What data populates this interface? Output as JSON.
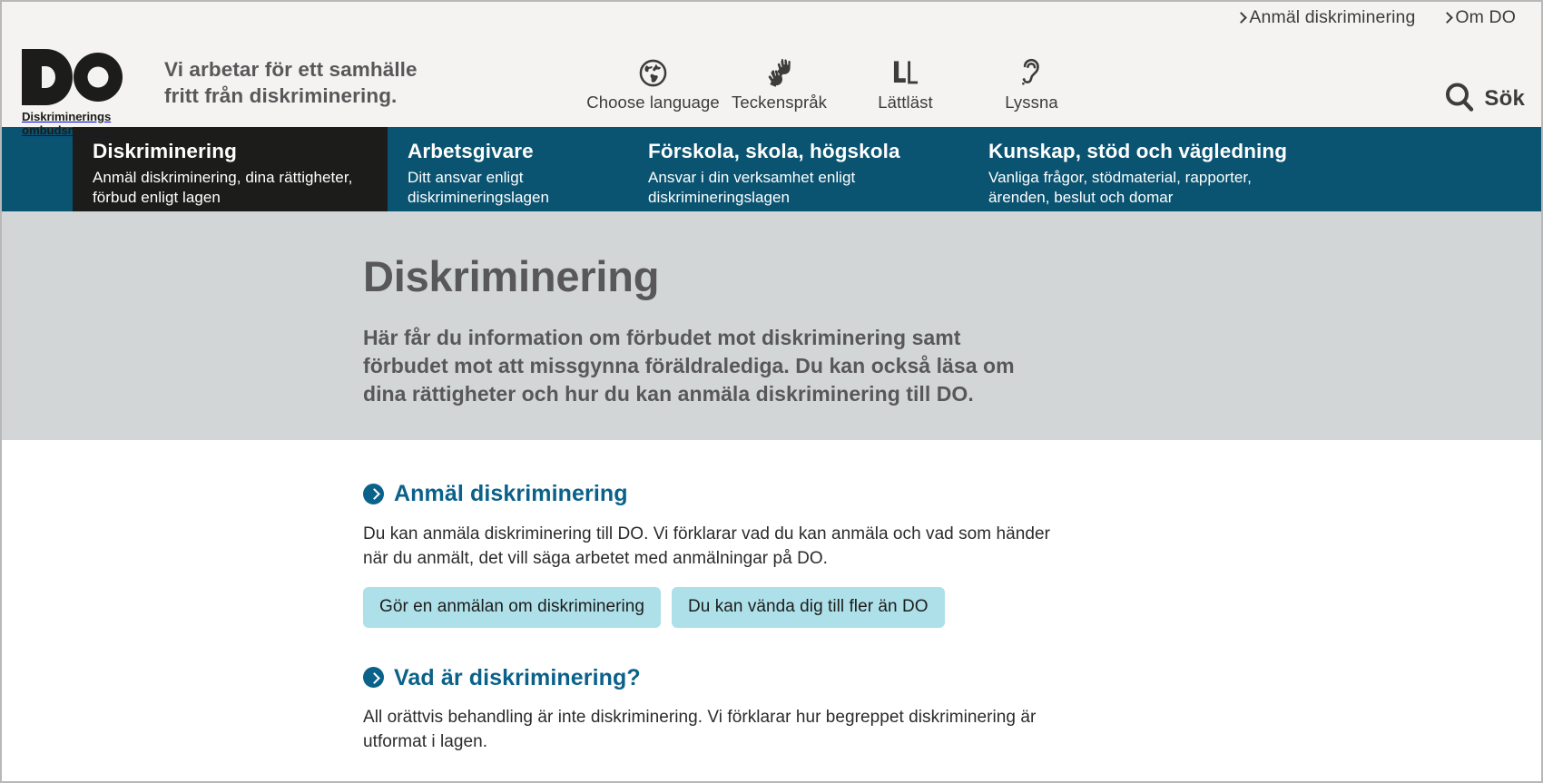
{
  "brand": {
    "logo_alt": "DO",
    "logo_words_line1": "Diskriminerings",
    "logo_words_line2": "ombudsmannen",
    "tagline_line1": "Vi arbetar för ett samhälle",
    "tagline_line2": "fritt från diskriminering."
  },
  "top_links": [
    {
      "label": "Anmäl diskriminering"
    },
    {
      "label": "Om DO"
    }
  ],
  "tools": [
    {
      "label": "Choose language",
      "icon": "globe-icon"
    },
    {
      "label": "Teckenspråk",
      "icon": "sign-language-hands-icon"
    },
    {
      "label": "Lättläst",
      "icon": "easy-read-LL-icon"
    },
    {
      "label": "Lyssna",
      "icon": "ear-listen-icon"
    }
  ],
  "search": {
    "label": "Sök",
    "icon": "search-icon"
  },
  "mainnav": [
    {
      "title": "Diskriminering",
      "sub_line1": "Anmäl diskriminering, dina rättigheter,",
      "sub_line2": "förbud enligt lagen",
      "active": true
    },
    {
      "title": "Arbetsgivare",
      "sub_line1": "Ditt ansvar enligt",
      "sub_line2": "diskrimineringslagen",
      "active": false
    },
    {
      "title": "Förskola, skola, högskola",
      "sub_line1": "Ansvar i din verksamhet enligt",
      "sub_line2": "diskrimineringslagen",
      "active": false
    },
    {
      "title": "Kunskap, stöd och vägledning",
      "sub_line1": "Vanliga frågor, stödmaterial, rapporter,",
      "sub_line2": "ärenden, beslut och domar",
      "active": false
    }
  ],
  "hero": {
    "title": "Diskriminering",
    "preamble": "Här får du information om förbudet mot diskriminering samt förbudet mot att missgynna föräldralediga. Du kan också läsa om dina rättigheter och hur du kan anmäla diskriminering till DO."
  },
  "blocks": [
    {
      "title": "Anmäl diskriminering",
      "text": "Du kan anmäla diskriminering till DO. Vi förklarar vad du kan anmäla och vad som händer när du anmält, det vill säga arbetet med anmälningar på DO.",
      "chips": [
        {
          "label": "Gör en anmälan om diskriminering"
        },
        {
          "label": "Du kan vända dig till fler än DO"
        }
      ]
    },
    {
      "title": "Vad är diskriminering?",
      "text": "All orättvis behandling är inte diskriminering. Vi förklarar hur begreppet diskriminering är utformat i lagen.",
      "chips": []
    }
  ],
  "colors": {
    "nav_teal": "#0a5471",
    "nav_active_dark": "#1c1c1a",
    "hero_grey": "#d2d6d7",
    "header_grey": "#f4f3f1",
    "link_blue": "#0a6189",
    "chip_blue": "#aee0ea",
    "body_text": "#2b2b2b",
    "muted_text": "#58585a"
  }
}
